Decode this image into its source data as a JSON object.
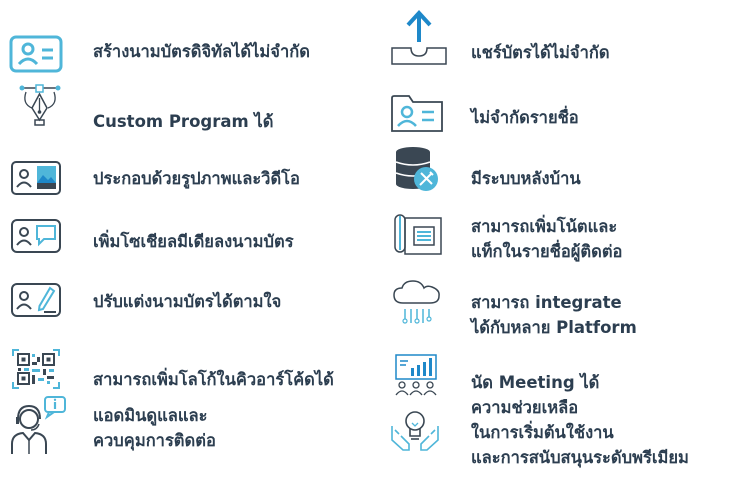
{
  "colors": {
    "accent": "#4fb6d9",
    "dark": "#3a4753",
    "text": "#2c3e50",
    "highlight": "#1e88c9"
  },
  "features_left": [
    {
      "icon": "contact-card-icon",
      "lines": [
        "สร้างนามบัตรดิจิทัลได้ไม่จำกัด"
      ]
    },
    {
      "icon": "pen-tool-icon",
      "lines": [
        "Custom Program ได้"
      ]
    },
    {
      "icon": "image-card-icon",
      "lines": [
        "ประกอบด้วยรูปภาพและวิดีโอ"
      ]
    },
    {
      "icon": "chat-card-icon",
      "lines": [
        "เพิ่มโซเชียลมีเดียลงนามบัตร"
      ]
    },
    {
      "icon": "edit-card-icon",
      "lines": [
        "ปรับแต่งนามบัตรได้ตามใจ"
      ]
    },
    {
      "icon": "qr-code-icon",
      "lines": [
        "สามารถเพิ่มโลโก้ในคิวอาร์โค้ดได้"
      ]
    },
    {
      "icon": "support-agent-icon",
      "lines": [
        "แอดมินดูแลและ",
        "ควบคุมการติดต่อ"
      ]
    }
  ],
  "features_right": [
    {
      "icon": "share-upload-icon",
      "lines": [
        "แชร์บัตรได้ไม่จำกัด"
      ]
    },
    {
      "icon": "contact-folder-icon",
      "lines": [
        "ไม่จำกัดรายชื่อ"
      ]
    },
    {
      "icon": "database-settings-icon",
      "lines": [
        "มีระบบหลังบ้าน"
      ]
    },
    {
      "icon": "notes-icon",
      "lines": [
        "สามารถเพิ่มโน้ตและ",
        "แท็กในรายชื่อผู้ติดต่อ"
      ]
    },
    {
      "icon": "cloud-integrate-icon",
      "lines": [
        "สามารถ integrate",
        "ได้กับหลาย Platform"
      ]
    },
    {
      "icon": "meeting-icon",
      "lines": [
        "นัด Meeting ได้"
      ]
    },
    {
      "icon": "lightbulb-hands-icon",
      "lines": [
        "ความช่วยเหลือ",
        "ในการเริ่มต้นใช้งาน",
        "และการสนับสนุนระดับพรีเมียม"
      ]
    }
  ]
}
